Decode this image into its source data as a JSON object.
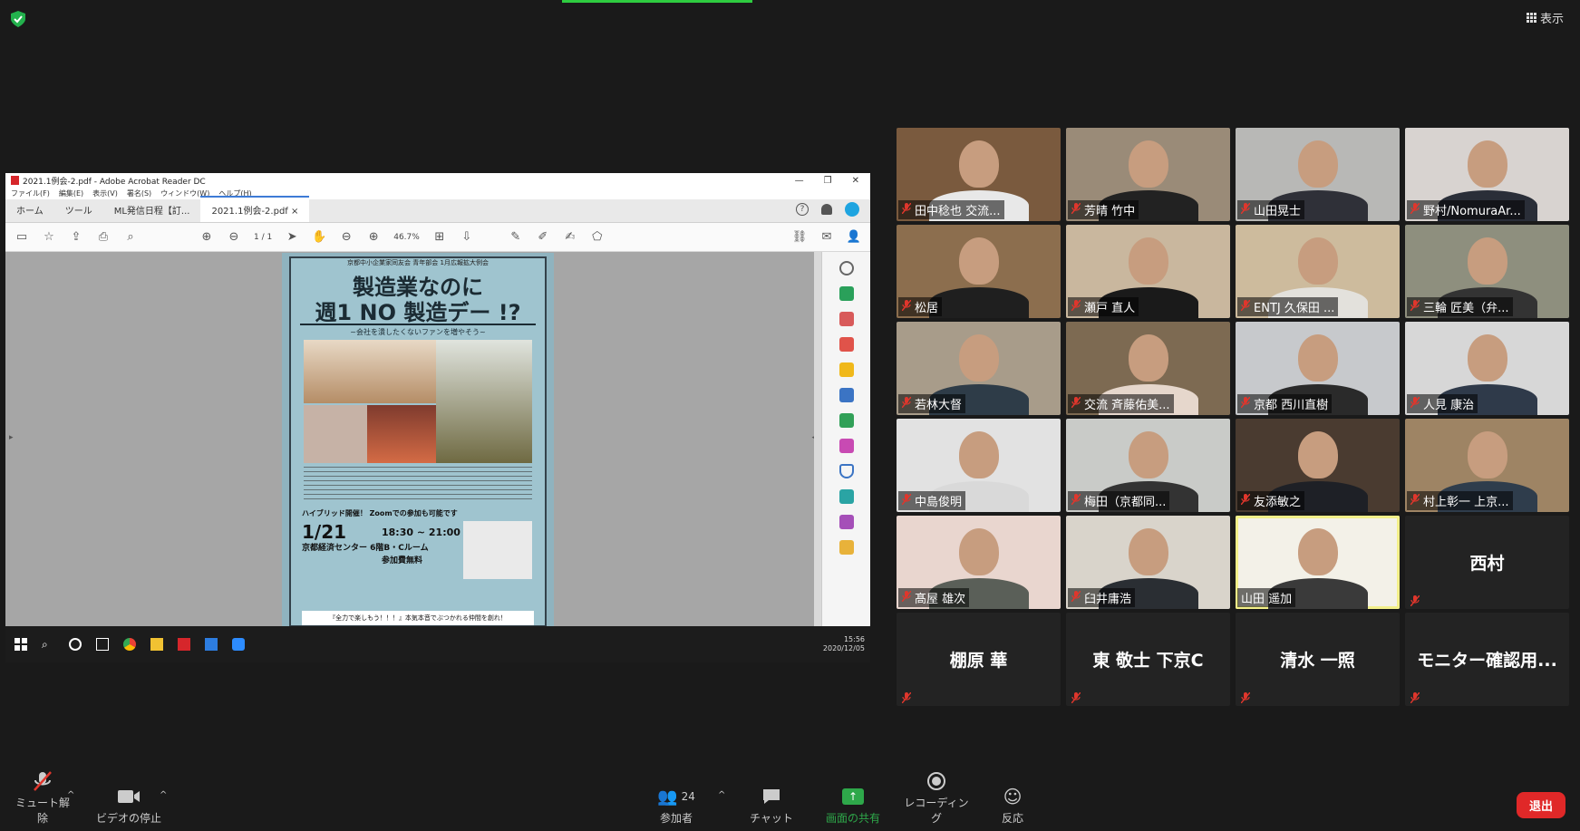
{
  "top": {
    "view_label": "表示"
  },
  "acrobat": {
    "window_title": "2021.1例会-2.pdf - Adobe Acrobat Reader DC",
    "menu": [
      "ファイル(F)",
      "編集(E)",
      "表示(V)",
      "署名(S)",
      "ウィンドウ(W)",
      "ヘルプ(H)"
    ],
    "tabs": [
      "ホーム",
      "ツール",
      "ML発信日程【訂...",
      "2021.1例会-2.pdf"
    ],
    "page_indicator": "1 / 1",
    "zoom_level": "46.7%"
  },
  "flyer": {
    "header": "京都中小企業家同友会 青年部会 1月広報拡大例会",
    "title_line1": "製造業なのに",
    "title_line2": "週1 NO 製造デー !?",
    "subtitle": "~会社を潰したくないファンを増やそう~",
    "hybrid": "ハイブリッド開催！ Zoomでの参加も可能です",
    "date": "1/21",
    "time": "18:30 ~ 21:00",
    "venue": "京都経済センター 6階B・Cルーム",
    "fee": "参加費無料",
    "bottom": "『全力で楽しもう！！！』本気本音でぶつかれる仲間を創れ！"
  },
  "taskbar": {
    "time": "15:56",
    "date": "2020/12/05"
  },
  "participants": [
    {
      "name": "田中稔也 交流...",
      "shirt": "#e8e8e8",
      "bg": "#7a5a3e"
    },
    {
      "name": "芳晴 竹中",
      "shirt": "#222222",
      "bg": "#9a8b78"
    },
    {
      "name": "山田晃士",
      "shirt": "#2f3038",
      "bg": "#b8b8b6"
    },
    {
      "name": "野村/NomuraAr...",
      "shirt": "#2a2e38",
      "bg": "#d8d3d0"
    },
    {
      "name": "松居",
      "shirt": "#1f1f1f",
      "bg": "#8c6e4e"
    },
    {
      "name": "瀬戸 直人",
      "shirt": "#1a1a1a",
      "bg": "#c9b79e"
    },
    {
      "name": "ENTJ 久保田 ...",
      "shirt": "#e3e1dc",
      "bg": "#cdbb9d"
    },
    {
      "name": "三輪 匠美（弁...",
      "shirt": "#333333",
      "bg": "#8e8f7e"
    },
    {
      "name": "若林大督",
      "shirt": "#2e3c48",
      "bg": "#a89c8a"
    },
    {
      "name": "交流 斉藤佑美...",
      "shirt": "#e6d7cc",
      "bg": "#7d6a52"
    },
    {
      "name": "京都 西川直樹",
      "shirt": "#2a2a2a",
      "bg": "#c7c9cc"
    },
    {
      "name": "人見 康治",
      "shirt": "#2f3a4a",
      "bg": "#d7d7d7"
    },
    {
      "name": "中島俊明",
      "shirt": "#d9d9d9",
      "bg": "#e2e2e2"
    },
    {
      "name": "梅田（京都同...",
      "shirt": "#333333",
      "bg": "#c9cbc8"
    },
    {
      "name": "友添敏之",
      "shirt": "#1e2026",
      "bg": "#4a3b30"
    },
    {
      "name": "村上彰一 上京...",
      "shirt": "#2f3d4c",
      "bg": "#9e8464"
    },
    {
      "name": "髙屋 雄次",
      "shirt": "#5a5f58",
      "bg": "#e9d6cf"
    },
    {
      "name": "臼井庸浩",
      "shirt": "#2a2e33",
      "bg": "#d9d4cb"
    },
    {
      "name": "山田 遥加",
      "shirt": "#3a3a3a",
      "bg": "#f3f1e8"
    }
  ],
  "no_video": [
    "西村",
    "棚原 華",
    "東 敬士 下京C",
    "清水 一照",
    "モニター確認用..."
  ],
  "bottombar": {
    "mute": "ミュート解除",
    "video": "ビデオの停止",
    "participants": "参加者",
    "participant_count": "24",
    "chat": "チャット",
    "share": "画面の共有",
    "record": "レコーディング",
    "react": "反応",
    "leave": "退出"
  },
  "colors": {
    "share_green": "#2ea84a",
    "leave_red": "#e02828",
    "active_speaker": "#f3f08a",
    "muted": "#e0362c"
  }
}
